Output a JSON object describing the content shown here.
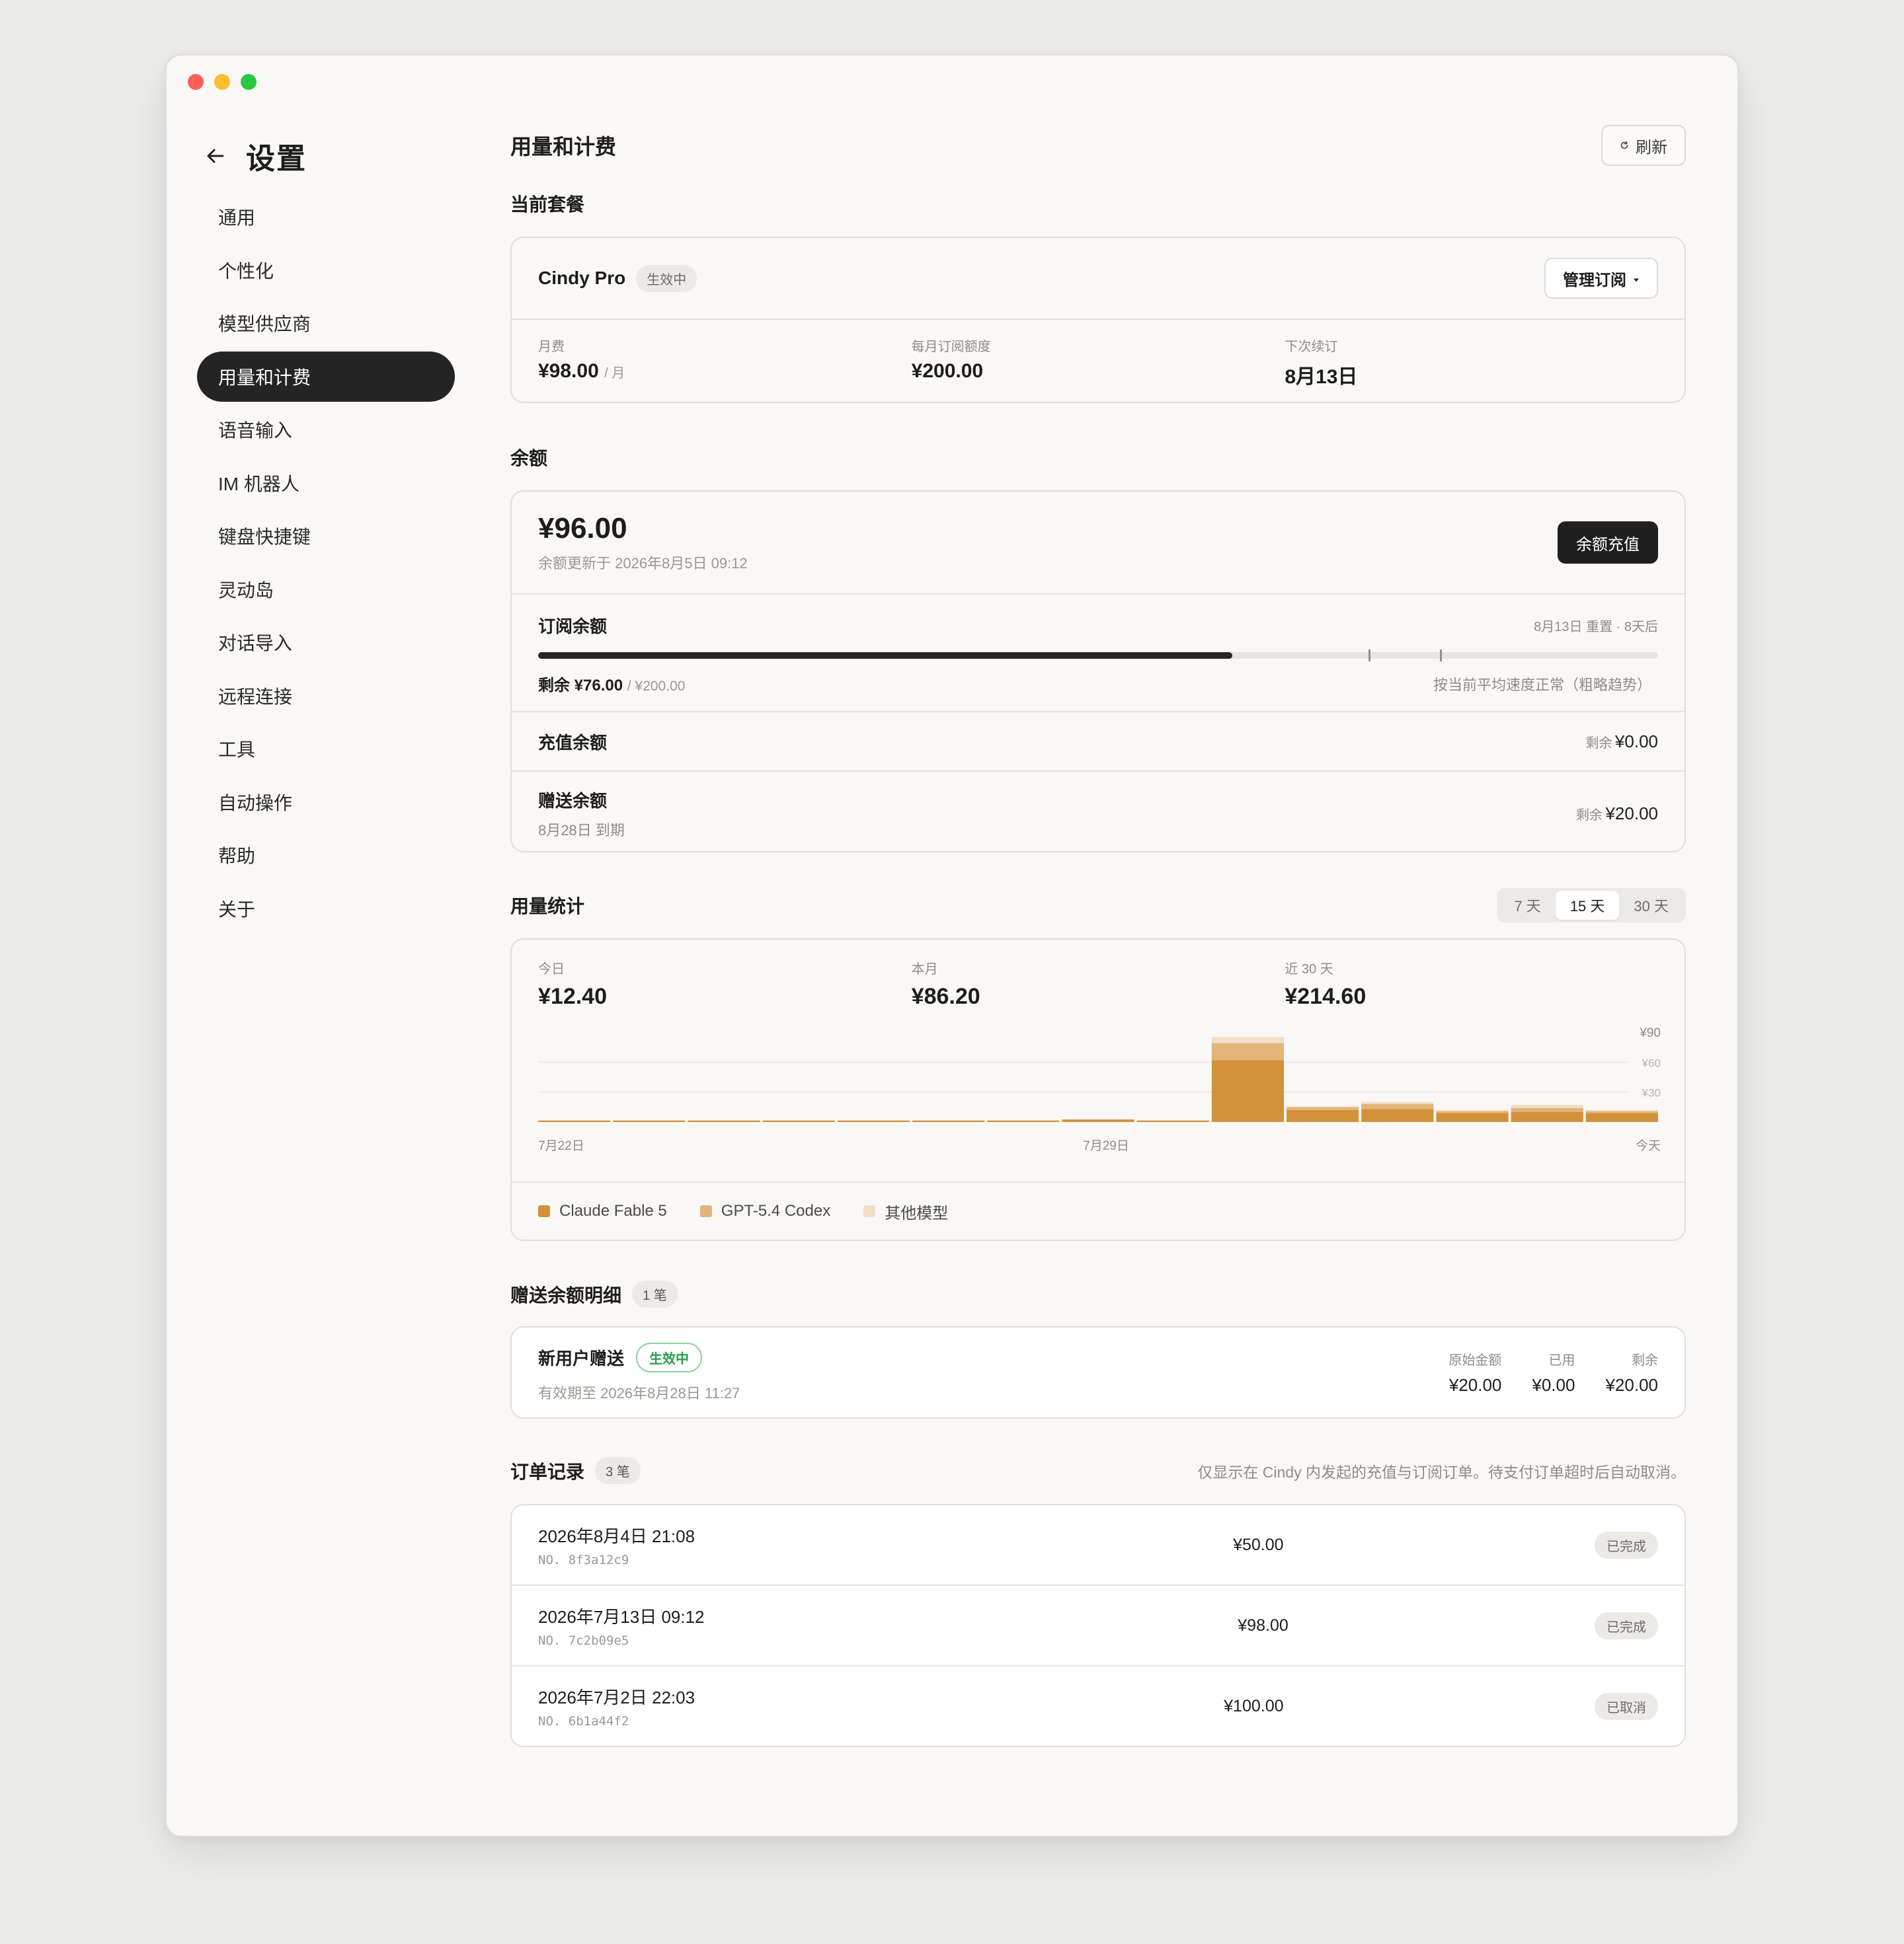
{
  "window": {
    "title": "设置"
  },
  "sidebar": {
    "back_icon": "arrow-left-icon",
    "title": "设置",
    "items": [
      {
        "label": "通用"
      },
      {
        "label": "个性化"
      },
      {
        "label": "模型供应商"
      },
      {
        "label": "用量和计费",
        "active": true
      },
      {
        "label": "语音输入"
      },
      {
        "label": "IM 机器人"
      },
      {
        "label": "键盘快捷键"
      },
      {
        "label": "灵动岛"
      },
      {
        "label": "对话导入"
      },
      {
        "label": "远程连接"
      },
      {
        "label": "工具"
      },
      {
        "label": "自动操作"
      },
      {
        "label": "帮助"
      },
      {
        "label": "关于"
      }
    ]
  },
  "header": {
    "title": "用量和计费",
    "refresh_label": "刷新",
    "refresh_icon": "refresh-icon"
  },
  "plan": {
    "section_title": "当前套餐",
    "name": "Cindy Pro",
    "status": "生效中",
    "manage_label": "管理订阅",
    "manage_icon": "caret-down-icon",
    "monthly_fee_label": "月费",
    "monthly_fee": "¥98.00",
    "monthly_fee_unit": "/ 月",
    "quota_label": "每月订阅额度",
    "quota": "¥200.00",
    "renew_label": "下次续订",
    "renew_date": "8月13日"
  },
  "balance": {
    "section_title": "余额",
    "amount": "¥96.00",
    "updated": "余额更新于 2026年8月5日 09:12",
    "topup_label": "余额充值",
    "subscription": {
      "title": "订阅余额",
      "reset_note": "8月13日 重置 · 8天后",
      "remaining_label": "剩余",
      "remaining": "¥76.00",
      "total": "/ ¥200.00",
      "trend_note": "按当前平均速度正常（粗略趋势）",
      "progress_fraction": 0.62
    },
    "recharge": {
      "title": "充值余额",
      "remaining_label": "剩余",
      "remaining": "¥0.00"
    },
    "gift": {
      "title": "赠送余额",
      "expiry": "8月28日 到期",
      "remaining_label": "剩余",
      "remaining": "¥20.00"
    }
  },
  "usage": {
    "section_title": "用量统计",
    "ranges": [
      "7 天",
      "15 天",
      "30 天"
    ],
    "active_range": "15 天",
    "today_label": "今日",
    "today": "¥12.40",
    "month_label": "本月",
    "month": "¥86.20",
    "last30_label": "近 30 天",
    "last30": "¥214.60",
    "legend": [
      "Claude Fable 5",
      "GPT-5.4 Codex",
      "其他模型"
    ]
  },
  "chart_data": {
    "type": "bar",
    "stacked": true,
    "y_ticks": [
      "¥90",
      "¥60",
      "¥30"
    ],
    "ylim": [
      0,
      90
    ],
    "x_tick_labels": [
      "7月22日",
      "7月29日",
      "今天"
    ],
    "grid": true,
    "colors": [
      "#d4913b",
      "#e2b47a",
      "#f0dfc6"
    ],
    "series": [
      {
        "name": "Claude Fable 5",
        "values": [
          1.5,
          1.5,
          1.5,
          1.5,
          1.5,
          1.5,
          1.5,
          2.5,
          1.5,
          62,
          12,
          13,
          9,
          10,
          9
        ]
      },
      {
        "name": "GPT-5.4 Codex",
        "values": [
          0,
          0,
          0,
          0,
          0,
          0,
          0,
          0,
          0,
          17,
          3,
          5,
          2,
          4,
          2
        ]
      },
      {
        "name": "其他模型",
        "values": [
          0,
          0,
          0,
          0,
          0,
          0,
          0,
          0,
          0,
          6,
          1,
          2,
          1,
          3,
          1
        ]
      }
    ]
  },
  "gift_details": {
    "section_title": "赠送余额明细",
    "count": "1 笔",
    "item": {
      "title": "新用户赠送",
      "status": "生效中",
      "expiry": "有效期至 2026年8月28日 11:27",
      "original_label": "原始金额",
      "original": "¥20.00",
      "used_label": "已用",
      "used": "¥0.00",
      "left_label": "剩余",
      "left": "¥20.00"
    }
  },
  "orders": {
    "section_title": "订单记录",
    "count": "3 笔",
    "note": "仅显示在 Cindy 内发起的充值与订阅订单。待支付订单超时后自动取消。",
    "items": [
      {
        "date": "2026年8月4日 21:08",
        "no": "NO. 8f3a12c9",
        "amount": "¥50.00",
        "status": "已完成"
      },
      {
        "date": "2026年7月13日 09:12",
        "no": "NO. 7c2b09e5",
        "amount": "¥98.00",
        "status": "已完成"
      },
      {
        "date": "2026年7月2日 22:03",
        "no": "NO. 6b1a44f2",
        "amount": "¥100.00",
        "status": "已取消"
      }
    ]
  }
}
